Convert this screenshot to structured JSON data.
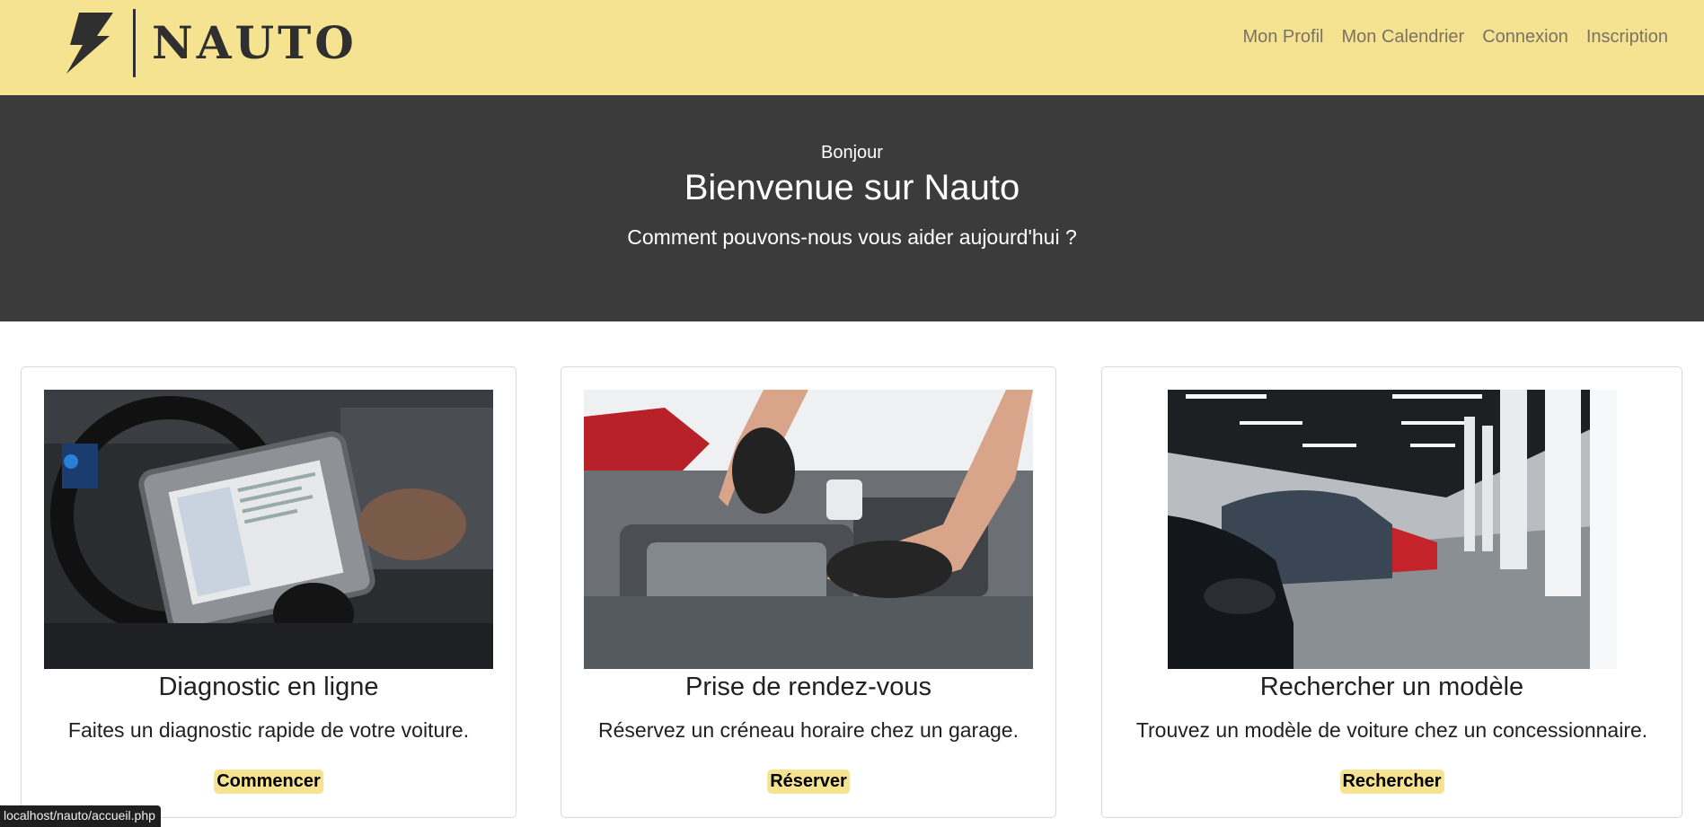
{
  "brand": {
    "name": "NAUTO",
    "logo_icon": "lightning-bolt-icon",
    "color": "#2f2f2f"
  },
  "nav": {
    "items": [
      {
        "label": "Mon Profil"
      },
      {
        "label": "Mon Calendrier"
      },
      {
        "label": "Connexion"
      },
      {
        "label": "Inscription"
      }
    ]
  },
  "hero": {
    "greeting": "Bonjour",
    "title": "Bienvenue sur Nauto",
    "subtitle": "Comment pouvons-nous vous aider aujourd'hui ?"
  },
  "cards": [
    {
      "title": "Diagnostic en ligne",
      "text": "Faites un diagnostic rapide de votre voiture.",
      "button": "Commencer"
    },
    {
      "title": "Prise de rendez-vous",
      "text": "Réservez un créneau horaire chez un garage.",
      "button": "Réserver"
    },
    {
      "title": "Rechercher un modèle",
      "text": "Trouvez un modèle de voiture chez un concessionnaire.",
      "button": "Rechercher"
    }
  ],
  "status_bar": {
    "url": "localhost/nauto/accueil.php"
  },
  "colors": {
    "accent_yellow": "#f6e391",
    "hero_background": "#3b3b3b",
    "nav_link": "#7a7364"
  }
}
